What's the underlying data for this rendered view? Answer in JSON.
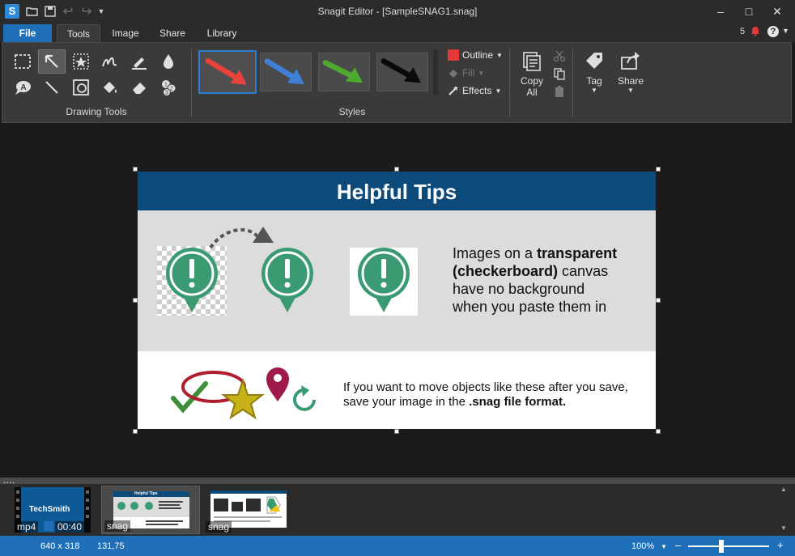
{
  "window": {
    "title": "Snagit Editor - [SampleSNAG1.snag]",
    "logo_letter": "S",
    "minimize": "–",
    "maximize": "□",
    "close": "✕"
  },
  "tabs": [
    {
      "label": "File"
    },
    {
      "label": "Tools"
    },
    {
      "label": "Image"
    },
    {
      "label": "Share"
    },
    {
      "label": "Library"
    }
  ],
  "notifications": {
    "count": "5",
    "help": "?"
  },
  "ribbon": {
    "drawing_tools_label": "Drawing Tools",
    "styles_label": "Styles",
    "styles": [
      {
        "color": "#e8423c"
      },
      {
        "color": "#3f7fd6"
      },
      {
        "color": "#4caa2e"
      },
      {
        "color": "#0a0a0a"
      }
    ],
    "outline_label": "Outline",
    "outline_color": "#e23a3a",
    "fill_label": "Fill",
    "effects_label": "Effects",
    "copy_all_label": "Copy All",
    "tag_label": "Tag",
    "share_label": "Share"
  },
  "image": {
    "header": "Helpful Tips",
    "tip_line1_a": "Images on a ",
    "tip_line1_b": "transparent",
    "tip_line2_b": "(checkerboard)",
    "tip_line2_a": " canvas",
    "tip_line3": "have no background",
    "tip_line4": "when you paste them in",
    "bottom_line1": "If you want to move objects like these after you save,",
    "bottom_line2_a": "save your image in the ",
    "bottom_line2_b": ".snag file format.",
    "pin_color": "#3a9a72",
    "header_color": "#0c4a7a"
  },
  "tray": {
    "items": [
      {
        "type": "mp4",
        "duration": "00:40",
        "brand": "TechSmith"
      },
      {
        "type": "snag",
        "title": "Helpful Tips"
      },
      {
        "type": "snag"
      }
    ]
  },
  "status": {
    "dimensions": "640 x 318",
    "cursor": "131,75",
    "zoom": "100%",
    "zoom_minus": "–",
    "zoom_plus": "+"
  }
}
